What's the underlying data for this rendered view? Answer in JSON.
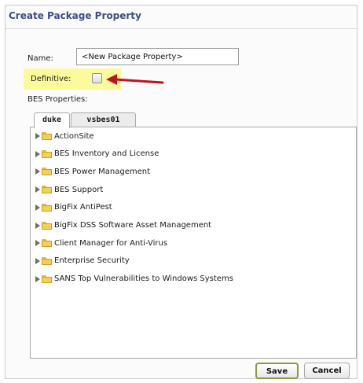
{
  "dialog": {
    "title": "Create Package Property"
  },
  "form": {
    "name_label": "Name:",
    "name_value": "<New Package Property>",
    "definitive_label": "Definitive:",
    "definitive_checked": false,
    "bes_properties_label": "BES Properties:"
  },
  "tabs": [
    {
      "label": "duke",
      "active": true
    },
    {
      "label": "vsbes01",
      "active": false
    }
  ],
  "tree": {
    "items": [
      {
        "label": "ActionSite",
        "icon": "folder-icon"
      },
      {
        "label": "BES Inventory and License",
        "icon": "folder-icon"
      },
      {
        "label": "BES Power Management",
        "icon": "folder-icon"
      },
      {
        "label": "BES Support",
        "icon": "folder-icon"
      },
      {
        "label": "BigFix AntiPest",
        "icon": "folder-icon"
      },
      {
        "label": "BigFix DSS Software Asset Management",
        "icon": "folder-icon"
      },
      {
        "label": "Client Manager for Anti-Virus",
        "icon": "folder-icon"
      },
      {
        "label": "Enterprise Security",
        "icon": "folder-icon"
      },
      {
        "label": "SANS Top Vulnerabilities to Windows Systems",
        "icon": "folder-icon"
      }
    ]
  },
  "buttons": {
    "save": "Save",
    "cancel": "Cancel"
  },
  "colors": {
    "title": "#3a4f86",
    "highlight": "#fbfb9d",
    "arrow": "#c0141b",
    "save_border": "#8a9a3e"
  }
}
